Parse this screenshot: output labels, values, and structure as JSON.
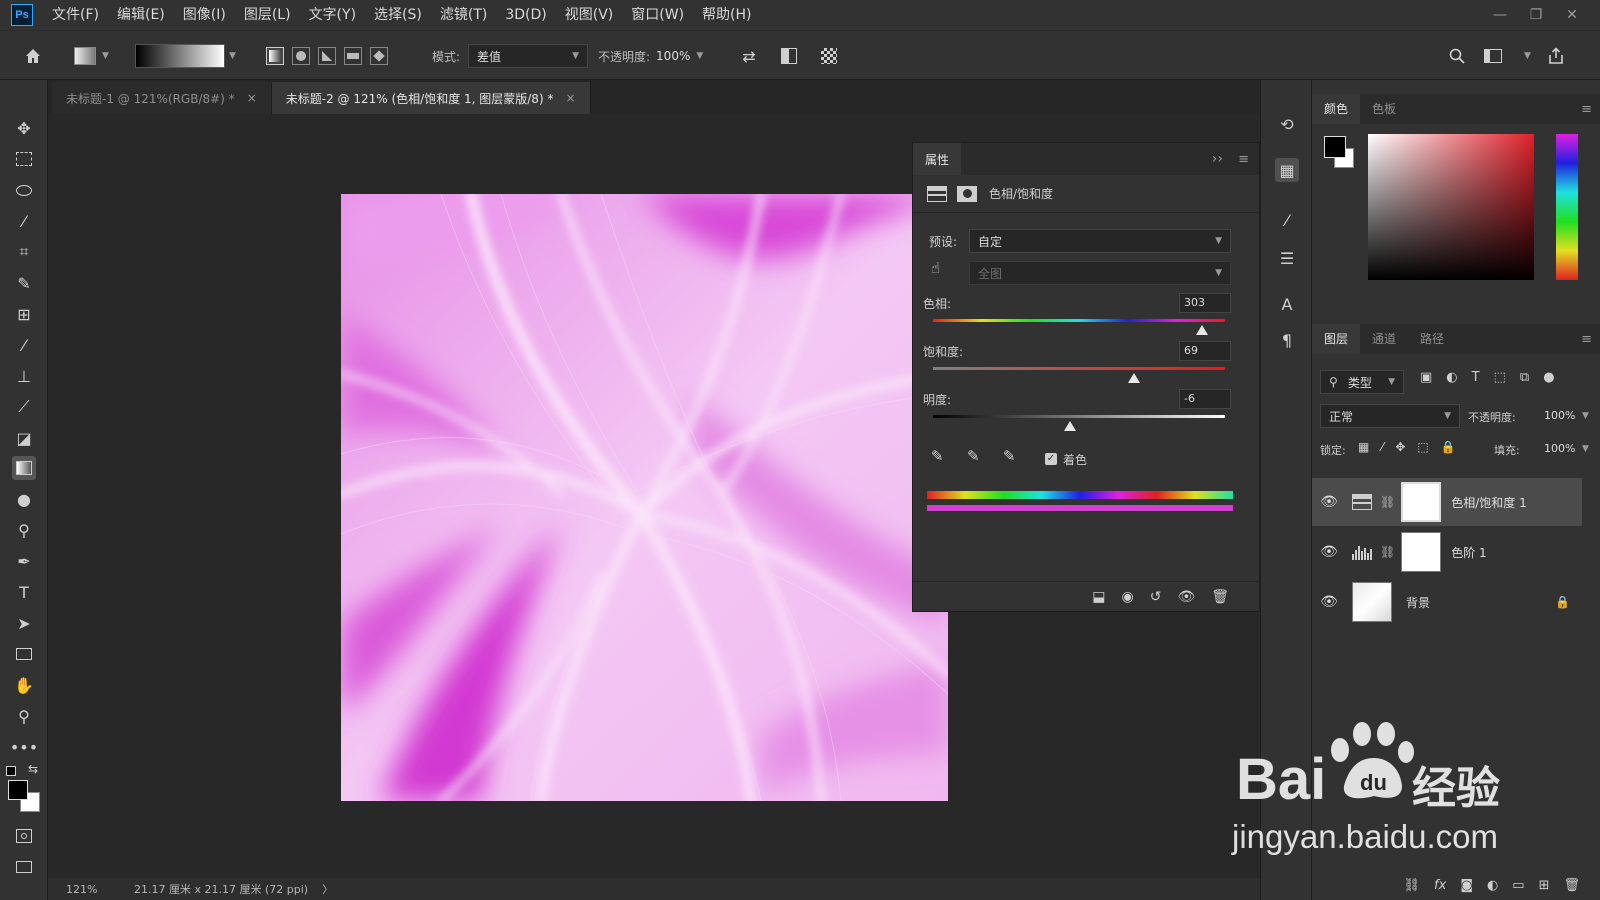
{
  "app": {
    "logo": "Ps"
  },
  "menu": [
    "文件(F)",
    "编辑(E)",
    "图像(I)",
    "图层(L)",
    "文字(Y)",
    "选择(S)",
    "滤镜(T)",
    "3D(D)",
    "视图(V)",
    "窗口(W)",
    "帮助(H)"
  ],
  "window_controls": {
    "minimize": "—",
    "restore": "❐",
    "close": "✕"
  },
  "options_bar": {
    "mode_label": "模式:",
    "mode_value": "差值",
    "opacity_label": "不透明度:",
    "opacity_value": "100%"
  },
  "tabs": [
    {
      "title": "未标题-1 @ 121%(RGB/8#) *",
      "close": "×"
    },
    {
      "title": "未标题-2 @ 121% (色相/饱和度 1, 图层蒙版/8) *",
      "close": "×"
    }
  ],
  "status": {
    "zoom": "121%",
    "doc_info": "21.17 厘米 x 21.17 厘米 (72 ppi)",
    "arrow": "〉"
  },
  "properties": {
    "tab": "属性",
    "adjustment_title": "色相/饱和度",
    "preset_label": "预设:",
    "preset_value": "自定",
    "range_value": "全图",
    "hue_label": "色相:",
    "hue_value": "303",
    "hue_fraction": 0.92,
    "saturation_label": "饱和度:",
    "saturation_value": "69",
    "saturation_fraction": 0.69,
    "lightness_label": "明度:",
    "lightness_value": "-6",
    "lightness_fraction": 0.47,
    "colorize_label": "着色",
    "colorize_checked": true,
    "colorize_color": "#d23fd2"
  },
  "color_panel": {
    "tabs": [
      "颜色",
      "色板"
    ],
    "foreground": "#000000",
    "background": "#ffffff",
    "hue_color": "#e0202a"
  },
  "layers_panel": {
    "tabs": [
      "图层",
      "通道",
      "路径"
    ],
    "filter_label": "类型",
    "blend_mode": "正常",
    "opacity_label": "不透明度:",
    "opacity_value": "100%",
    "lock_label": "锁定:",
    "fill_label": "填充:",
    "fill_value": "100%",
    "layers": [
      {
        "name": "色相/饱和度 1",
        "type": "hue-saturation",
        "selected": true
      },
      {
        "name": "色阶 1",
        "type": "levels",
        "selected": false
      },
      {
        "name": "背景",
        "type": "background",
        "selected": false,
        "locked": true
      }
    ]
  },
  "watermark": {
    "brand": "Bai",
    "brand2": "经验",
    "url": "jingyan.baidu.com"
  }
}
